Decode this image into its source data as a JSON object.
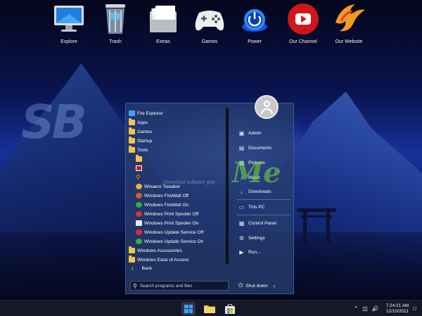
{
  "desktop": {
    "icons": [
      {
        "label": "Explore",
        "icon": "monitor-icon"
      },
      {
        "label": "Trash",
        "icon": "trash-icon"
      },
      {
        "label": "Extras",
        "icon": "documents-icon"
      },
      {
        "label": "Games",
        "icon": "gamepad-icon"
      },
      {
        "label": "Power",
        "icon": "power-icon"
      },
      {
        "label": "Our Channel",
        "icon": "youtube-icon"
      },
      {
        "label": "Our Website",
        "icon": "phoenix-logo-icon"
      }
    ],
    "watermark": "SB",
    "watermark_right": "Me",
    "watermark_text": "Download software grat"
  },
  "start_menu": {
    "programs": [
      {
        "label": "File Explorer",
        "icon": "file-explorer-icon"
      },
      {
        "label": "Apps",
        "icon": "folder-icon"
      },
      {
        "label": "Games",
        "icon": "folder-icon"
      },
      {
        "label": "Startup",
        "icon": "folder-icon"
      },
      {
        "label": "Tools",
        "icon": "folder-icon"
      },
      {
        "label": "",
        "icon": "folder-icon"
      },
      {
        "label": "",
        "icon": "red-app-icon"
      },
      {
        "label": "",
        "icon": "search-icon"
      },
      {
        "label": "Winaero Tweaker",
        "icon": "winaero-icon"
      },
      {
        "label": "Windows FireWall Off",
        "icon": "firewall-off-icon"
      },
      {
        "label": "Windows FireWall On",
        "icon": "firewall-on-icon"
      },
      {
        "label": "Windows Print Spooler Off",
        "icon": "spooler-off-icon"
      },
      {
        "label": "Windows Print Spooler On",
        "icon": "printer-icon"
      },
      {
        "label": "Windows Update Service Off",
        "icon": "update-off-icon"
      },
      {
        "label": "Windows Update Service On",
        "icon": "update-on-icon"
      },
      {
        "label": "Windows Accessories",
        "icon": "folder-icon"
      },
      {
        "label": "Windows Ease of Access",
        "icon": "folder-icon"
      }
    ],
    "back_label": "Back",
    "search_placeholder": "Search programs and files",
    "right_items": [
      {
        "label": "Admin",
        "icon": "user-folder-icon"
      },
      {
        "label": "Documents",
        "icon": "documents-icon"
      },
      {
        "label": "Pictures",
        "icon": "pictures-icon"
      },
      {
        "label": "Music",
        "icon": "music-icon"
      },
      {
        "label": "Downloads",
        "icon": "download-icon"
      },
      {
        "label": "This PC",
        "icon": "computer-icon"
      },
      {
        "label": "Control Panel",
        "icon": "control-panel-icon"
      },
      {
        "label": "Settings",
        "icon": "gear-icon"
      },
      {
        "label": "Run...",
        "icon": "run-icon"
      }
    ],
    "shutdown_label": "Shut down"
  },
  "taskbar": {
    "time": "7:24:21 AM",
    "date": "12/10/2021"
  },
  "colors": {
    "folder": "#f3c44b",
    "accent": "#3da2ff"
  }
}
